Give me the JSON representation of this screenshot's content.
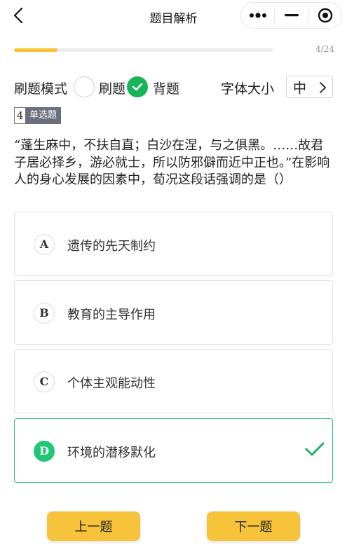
{
  "nav": {
    "title": "题目解析"
  },
  "progress": {
    "current": 4,
    "total": 24,
    "label": "4/24",
    "accent": "#f7c33a"
  },
  "mode": {
    "label": "刷题模式",
    "options": [
      {
        "label": "刷题",
        "selected": false
      },
      {
        "label": "背题",
        "selected": true
      }
    ],
    "selected_color": "#19b45a"
  },
  "font_size": {
    "label": "字体大小",
    "value": "中"
  },
  "question": {
    "number": "4",
    "type": "单选题",
    "text": "“蓬生麻中，不扶自直；白沙在涅，与之俱黑。……故君子居必择乡，游必就士，所以防邪僻而近中正也。”在影响人的身心发展的因素中，荀况这段话强调的是（）",
    "options": [
      {
        "letter": "A",
        "text": "遗传的先天制约",
        "correct": false
      },
      {
        "letter": "B",
        "text": "教育的主导作用",
        "correct": false
      },
      {
        "letter": "C",
        "text": "个体主观能动性",
        "correct": false
      },
      {
        "letter": "D",
        "text": "环境的潜移默化",
        "correct": true
      }
    ],
    "correct_color": "#1fc675"
  },
  "footer": {
    "prev_label": "上一题",
    "next_label": "下一题"
  },
  "icons": {
    "back": "back-chevron-icon",
    "more": "more-dots-icon",
    "minimize": "minimize-icon",
    "close": "target-close-icon",
    "check": "check-icon",
    "chevron": "chevron-right-icon"
  }
}
